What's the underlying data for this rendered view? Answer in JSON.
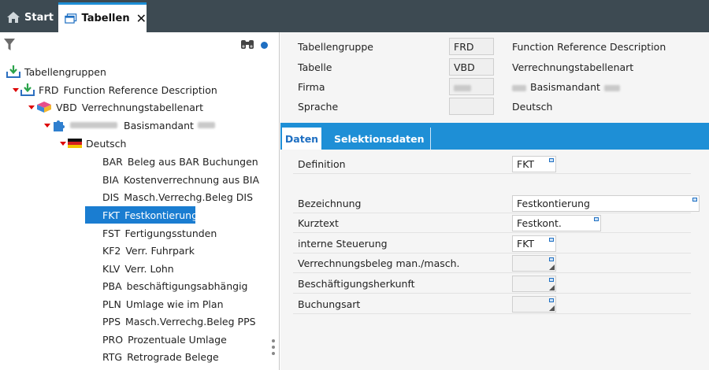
{
  "tabs": {
    "start": "Start",
    "tabellen": "Tabellen",
    "close": "✕"
  },
  "tree": {
    "root": "Tabellengruppen",
    "frd": {
      "code": "FRD",
      "label": "Function Reference Description"
    },
    "vbd": {
      "code": "VBD",
      "label": "Verrechnungstabellenart"
    },
    "mandant": {
      "label": "Basismandant"
    },
    "language": "Deutsch",
    "items": [
      {
        "code": "BAR",
        "label": "Beleg aus BAR Buchungen"
      },
      {
        "code": "BIA",
        "label": "Kostenverrechnung aus BIA"
      },
      {
        "code": "DIS",
        "label": "Masch.Verrechg.Beleg DIS"
      },
      {
        "code": "FKT",
        "label": "Festkontierung",
        "selected": true
      },
      {
        "code": "FST",
        "label": "Fertigungsstunden"
      },
      {
        "code": "KF2",
        "label": "Verr. Fuhrpark"
      },
      {
        "code": "KLV",
        "label": "Verr. Lohn"
      },
      {
        "code": "PBA",
        "label": "beschäftigungsabhängig"
      },
      {
        "code": "PLN",
        "label": "Umlage wie im Plan"
      },
      {
        "code": "PPS",
        "label": "Masch.Verrechg.Beleg PPS"
      },
      {
        "code": "PRO",
        "label": "Prozentuale Umlage"
      },
      {
        "code": "RTG",
        "label": "Retrograde Belege"
      }
    ]
  },
  "header": {
    "tabellengruppe": {
      "label": "Tabellengruppe",
      "value": "FRD",
      "desc": "Function Reference Description"
    },
    "tabelle": {
      "label": "Tabelle",
      "value": "VBD",
      "desc": "Verrechnungstabellenart"
    },
    "firma": {
      "label": "Firma",
      "value": "",
      "desc": "Basismandant"
    },
    "sprache": {
      "label": "Sprache",
      "value": "",
      "desc": "Deutsch"
    }
  },
  "detail_tabs": {
    "daten": "Daten",
    "selektionsdaten": "Selektionsdaten"
  },
  "form": {
    "definition": {
      "label": "Definition",
      "value": "FKT"
    },
    "bezeichnung": {
      "label": "Bezeichnung",
      "value": "Festkontierung"
    },
    "kurztext": {
      "label": "Kurztext",
      "value": "Festkont."
    },
    "interne_steuerung": {
      "label": "interne Steuerung",
      "value": "FKT"
    },
    "verrechnungsbeleg": {
      "label": "Verrechnungsbeleg man./masch.",
      "value": ""
    },
    "beschaeftigungsherkunft": {
      "label": "Beschäftigungsherkunft",
      "value": ""
    },
    "buchungsart": {
      "label": "Buchungsart",
      "value": ""
    }
  },
  "colors": {
    "accent": "#1e8fd6",
    "tabbar": "#3d4a52",
    "selection": "#1a7dd1",
    "expander": "#dd0000"
  }
}
